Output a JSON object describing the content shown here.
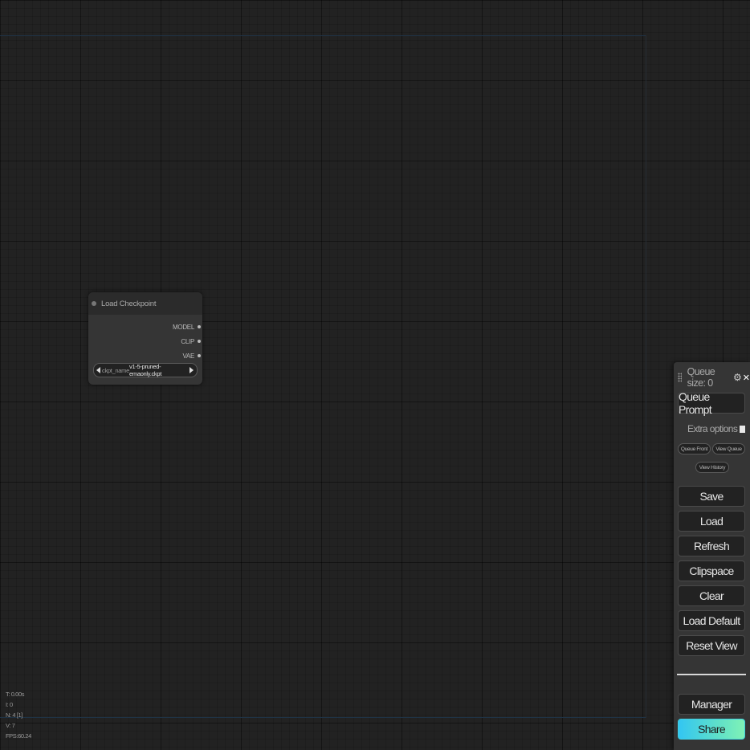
{
  "node": {
    "title": "Load Checkpoint",
    "outputs": [
      "MODEL",
      "CLIP",
      "VAE"
    ],
    "widget": {
      "label": "ckpt_name",
      "value": "v1-5-pruned-emaonly.ckpt"
    }
  },
  "stats": {
    "t": "T: 0.00s",
    "i": "I: 0",
    "n": "N: 4 [1]",
    "v": "V: 7",
    "fps": "FPS:60.24"
  },
  "menu": {
    "queue_size": "Queue size: 0",
    "queue_prompt": "Queue Prompt",
    "extra_options": "Extra options",
    "queue_front": "Queue Front",
    "view_queue": "View Queue",
    "view_history": "View History",
    "save": "Save",
    "load": "Load",
    "refresh": "Refresh",
    "clipspace": "Clipspace",
    "clear": "Clear",
    "load_default": "Load Default",
    "reset_view": "Reset View",
    "manager": "Manager",
    "share": "Share"
  },
  "icons": {
    "drag": "drag-handle-icon",
    "settings": "gear-icon",
    "close": "close-icon",
    "share_gradient": [
      "#33c6f2",
      "#7ff2b6"
    ]
  }
}
